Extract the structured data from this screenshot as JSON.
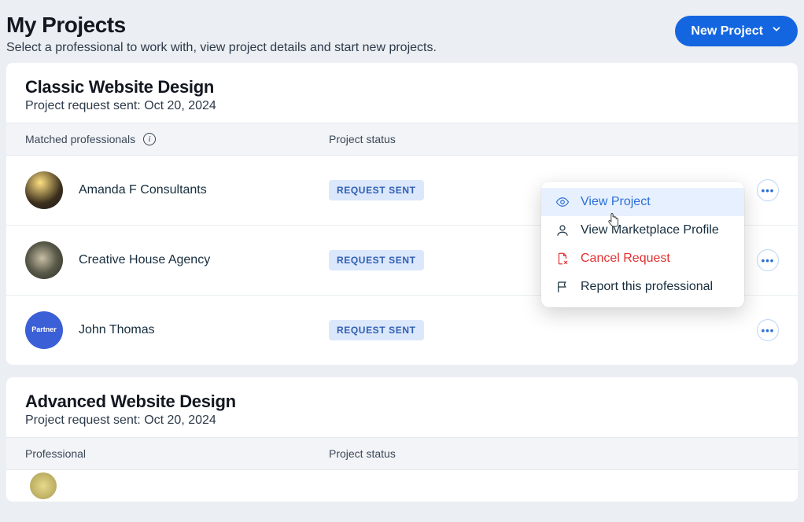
{
  "header": {
    "title": "My Projects",
    "subtitle": "Select a professional to work with, view project details and start new projects.",
    "new_project_label": "New Project"
  },
  "projects": [
    {
      "title": "Classic Website Design",
      "sent_line": "Project request sent: Oct 20, 2024",
      "col_pro": "Matched professionals",
      "col_status": "Project status",
      "rows": [
        {
          "name": "Amanda F Consultants",
          "status": "REQUEST SENT"
        },
        {
          "name": "Creative House Agency",
          "status": "REQUEST SENT"
        },
        {
          "name": "John Thomas",
          "status": "REQUEST SENT",
          "badge_text": "Partner"
        }
      ]
    },
    {
      "title": "Advanced Website Design",
      "sent_line": "Project request sent: Oct 20, 2024",
      "col_pro": "Professional",
      "col_status": "Project status",
      "rows": []
    }
  ],
  "menu": {
    "view_project": "View Project",
    "view_profile": "View Marketplace Profile",
    "cancel": "Cancel Request",
    "report": "Report this professional"
  }
}
